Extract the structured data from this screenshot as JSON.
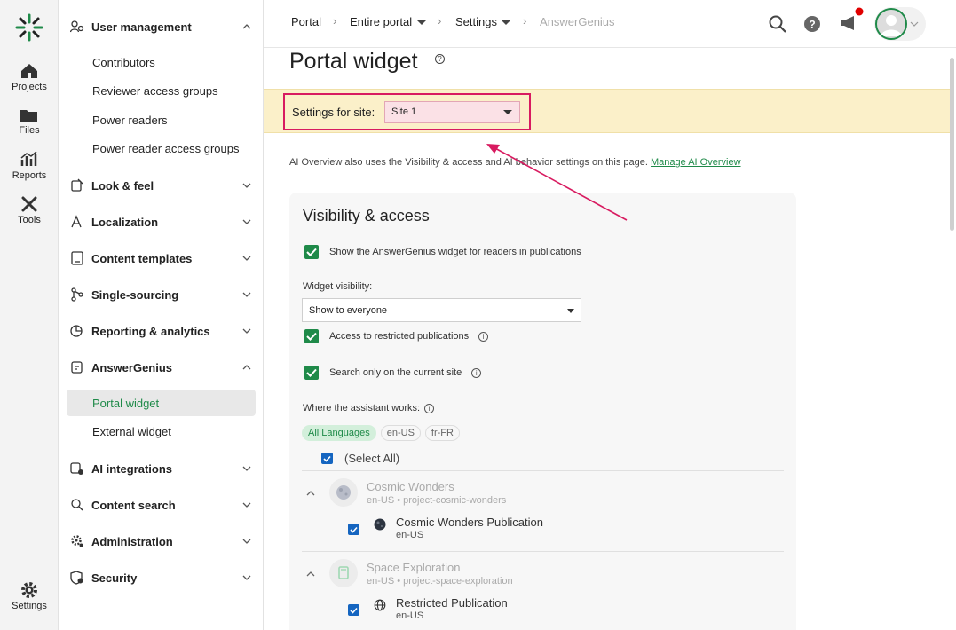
{
  "rail": {
    "items": [
      {
        "label": "Projects",
        "icon": "home-icon"
      },
      {
        "label": "Files",
        "icon": "folder-icon"
      },
      {
        "label": "Reports",
        "icon": "reports-icon"
      },
      {
        "label": "Tools",
        "icon": "tools-icon"
      }
    ],
    "settings_label": "Settings"
  },
  "menu": {
    "user_management": "User management",
    "contributors": "Contributors",
    "reviewer_access_groups": "Reviewer access groups",
    "power_readers": "Power readers",
    "power_reader_access_groups": "Power reader access groups",
    "look_and_feel": "Look & feel",
    "localization": "Localization",
    "content_templates": "Content templates",
    "single_sourcing": "Single-sourcing",
    "reporting_analytics": "Reporting & analytics",
    "answergenius": "AnswerGenius",
    "portal_widget": "Portal widget",
    "external_widget": "External widget",
    "ai_integrations": "AI integrations",
    "content_search": "Content search",
    "administration": "Administration",
    "security": "Security"
  },
  "breadcrumb": {
    "portal": "Portal",
    "entire_portal": "Entire portal",
    "settings": "Settings",
    "answergenius": "AnswerGenius"
  },
  "page": {
    "title": "Portal widget",
    "settings_for_site_label": "Settings for site:",
    "site_value": "Site 1",
    "info_text": "AI Overview also uses the Visibility & access and AI behavior settings on this page. ",
    "info_link": "Manage AI Overview"
  },
  "visibility": {
    "title": "Visibility & access",
    "show_widget_label": "Show the AnswerGenius widget for readers in publications",
    "widget_visibility_label": "Widget visibility:",
    "widget_visibility_value": "Show to everyone",
    "restricted_label": "Access to restricted publications",
    "current_site_label": "Search only on the current site",
    "where_label": "Where the assistant works:",
    "chips": [
      "All Languages",
      "en-US",
      "fr-FR"
    ],
    "select_all": "(Select All)",
    "groups": [
      {
        "name": "Cosmic Wonders",
        "meta": "en-US • project-cosmic-wonders",
        "publication": {
          "name": "Cosmic Wonders Publication",
          "lang": "en-US"
        }
      },
      {
        "name": "Space Exploration",
        "meta": "en-US • project-space-exploration",
        "publication": {
          "name": "Restricted Publication",
          "lang": "en-US"
        }
      }
    ]
  },
  "colors": {
    "accent": "#1f8a49",
    "highlight_border": "#d81b60",
    "banner": "#fbf0c9",
    "checkbox_blue": "#1565c0"
  }
}
